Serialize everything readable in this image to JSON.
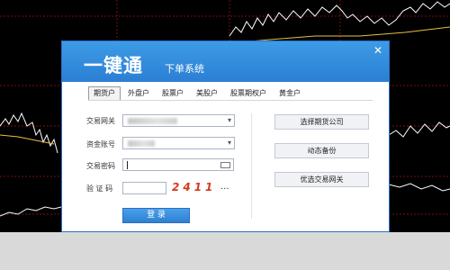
{
  "window": {
    "title": "一键通",
    "subtitle": "下单系统"
  },
  "tabs": [
    {
      "label": "期货户",
      "active": true
    },
    {
      "label": "外盘户",
      "active": false
    },
    {
      "label": "股票户",
      "active": false
    },
    {
      "label": "美股户",
      "active": false
    },
    {
      "label": "股票期权户",
      "active": false
    },
    {
      "label": "黄金户",
      "active": false
    }
  ],
  "form": {
    "gateway_label": "交易网关",
    "account_label": "资金账号",
    "password_label": "交易密码",
    "captcha_label": "验 证 码",
    "captcha_code": "2411",
    "captcha_more": "...",
    "login_label": "登 录"
  },
  "side_buttons": {
    "select_broker": "选择期货公司",
    "dynamic_backup": "动态备份",
    "preferred_gateway": "优选交易网关"
  },
  "colors": {
    "title_bar": "#2b7fd3",
    "login_button": "#3a8fe0",
    "captcha_text": "#d23a20",
    "chart_line": "#ffffff",
    "chart_grid": "#7a1010"
  },
  "icons": {
    "close": "close-icon",
    "dropdown": "chevron-down-icon",
    "keyboard": "keyboard-icon"
  }
}
